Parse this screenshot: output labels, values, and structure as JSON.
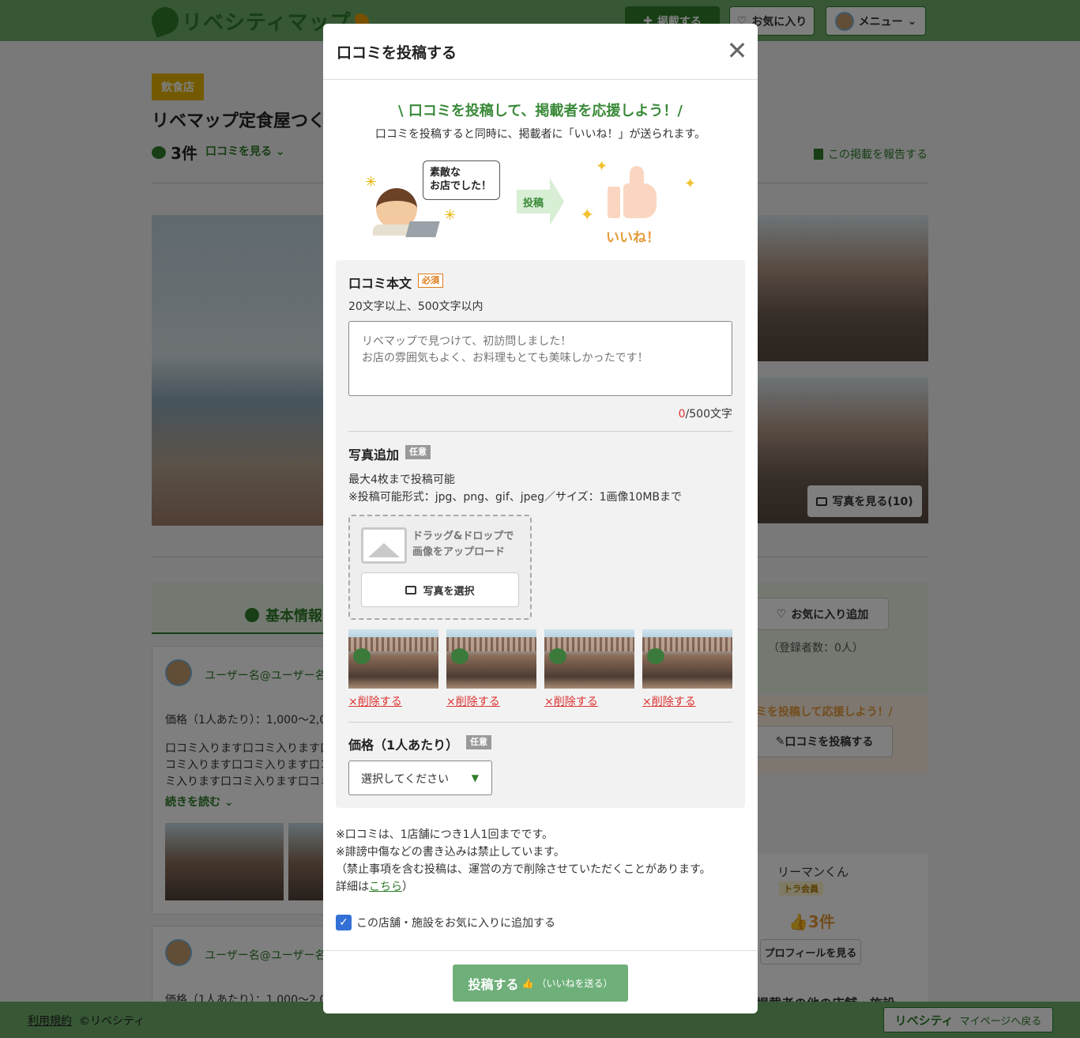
{
  "header": {
    "logo_text": "リベシティマップ",
    "post_label": "掲載する",
    "favorites_label": "お気に入り",
    "menu_label": "メニュー"
  },
  "shop": {
    "category": "飲食店",
    "title": "リベマップ定食屋つく",
    "review_count": "3件",
    "review_link": "口コミを見る",
    "report_link": "この掲載を報告する",
    "more_photos": "写真を見る(10)"
  },
  "info": {
    "tab_label": "基本情報",
    "fav_add": "お気に入り追加",
    "fav_registered": "（登録者数：0人）",
    "cta_text": "ミを投稿して応援しよう！/",
    "cta_button": "口コミを投稿する"
  },
  "reviews": [
    {
      "user": "ユーザー名@ユーザー名",
      "price": "価格（1人あたり）：1,000〜2,0",
      "body": [
        "口コミ入ります口コミ入ります口",
        "コミ入ります口コミ入ります口コ",
        "ミ入ります口コミ入ります口コミ"
      ],
      "more": "続きを読む"
    },
    {
      "user": "ユーザー名@ユーザー名",
      "price": "価格（1人あたり）：1,000〜2,0"
    }
  ],
  "poster": {
    "name": "リーマンくん",
    "rank": "トラ会員",
    "likes": "3件",
    "profile_button": "プロフィールを見る",
    "more_heading": "掲載者の他の店舗・施設"
  },
  "footer": {
    "terms": "利用規約",
    "copyright": "©リベシティ",
    "mypage_logo": "リベシティ",
    "mypage_label": "マイページへ戻る"
  },
  "modal": {
    "title": "口コミを投稿する",
    "close_label": "✕",
    "cta_title": "\\ 口コミを投稿して、掲載者を応援しよう！/",
    "cta_sub": "口コミを投稿すると同時に、掲載者に「いいね！」が送られます。",
    "illustration": {
      "speech_line1": "素敵な",
      "speech_line2": "お店でした！",
      "arrow_label": "投稿",
      "like_label": "いいね！"
    },
    "body_section": {
      "label": "口コミ本文",
      "required": "必須",
      "hint": "20文字以上、500文字以内",
      "placeholder": "リベマップで見つけて、初訪問しました！\nお店の雰囲気もよく、お料理もとても美味しかったです！",
      "value": "",
      "count_current": "0",
      "count_max": "/500文字"
    },
    "photo_section": {
      "label": "写真追加",
      "optional": "任意",
      "note1": "最大4枚まで投稿可能",
      "note2": "※投稿可能形式：jpg、png、gif、jpeg／サイズ：1画像10MBまで",
      "drop_line1": "ドラッグ&ドロップで",
      "drop_line2": "画像をアップロード",
      "select_button": "写真を選択",
      "delete_label": "×削除する"
    },
    "price_section": {
      "label": "価格（1人あたり）",
      "optional": "任意",
      "selected": "選択してください"
    },
    "rules": {
      "line1": "※口コミは、1店舗につき1人1回までです。",
      "line2": "※誹謗中傷などの書き込みは禁止しています。",
      "line3": "（禁止事項を含む投稿は、運営の方で削除させていただくことがあります。",
      "line4_prefix": "詳細は",
      "line4_link": "こちら",
      "line4_suffix": "）"
    },
    "favorite_check": {
      "checked": true,
      "label": "この店舗・施設をお気に入りに追加する"
    },
    "submit": {
      "main": "投稿する",
      "sub": "（いいねを送る）"
    }
  },
  "colors": {
    "brand_green": "#2f7d2a",
    "header_green": "#6fae6a",
    "accent_orange": "#e69a3a",
    "error_red": "#d33",
    "submit_green": "#6fb07a"
  }
}
